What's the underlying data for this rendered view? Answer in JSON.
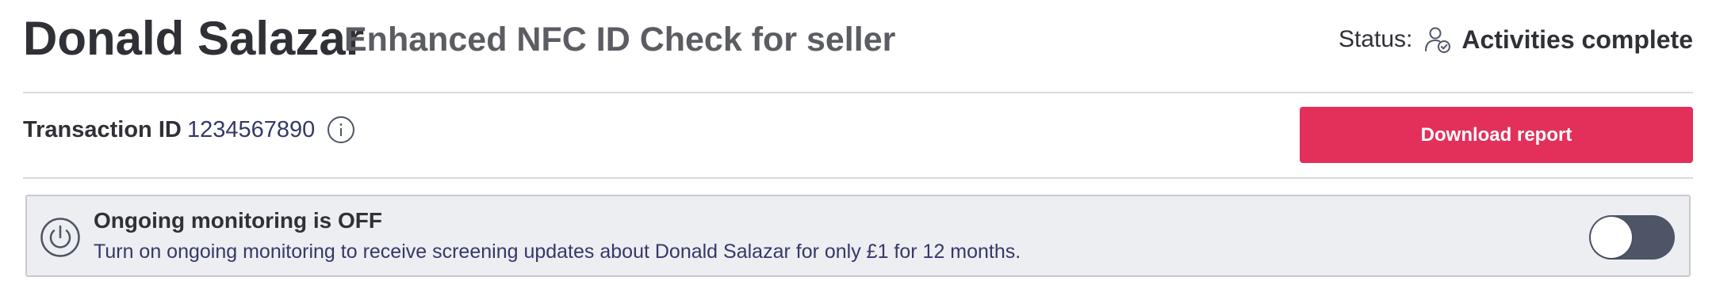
{
  "header": {
    "name": "Donald Salazar",
    "check_type": "Enhanced NFC ID Check for seller",
    "status_label": "Status:",
    "status_icon": "user-check-icon",
    "status_value": "Activities complete"
  },
  "transaction": {
    "label": "Transaction ID",
    "value": "1234567890",
    "info_icon": "info-icon",
    "download_label": "Download report"
  },
  "monitoring": {
    "icon": "power-icon",
    "title": "Ongoing monitoring is OFF",
    "description": "Turn on ongoing monitoring to receive screening updates about Donald Salazar for only £1 for 12 months.",
    "enabled": false
  },
  "colors": {
    "accent": "#e3305a",
    "toggle_off": "#4d5566",
    "banner_bg": "#eceef1",
    "value_text": "#36386a"
  }
}
